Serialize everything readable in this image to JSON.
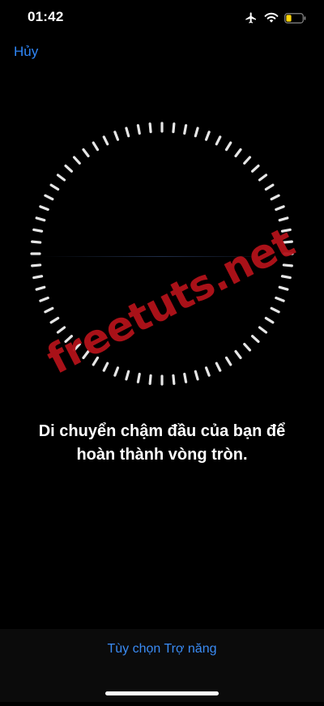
{
  "status_bar": {
    "time": "01:42",
    "icons": [
      "airplane-icon",
      "wifi-icon",
      "battery-icon"
    ],
    "battery_color": "#ffd60a"
  },
  "header": {
    "cancel_label": "Hủy"
  },
  "scan_ring": {
    "tick_count": 68,
    "tick_color": "#e6e6e6"
  },
  "watermark": {
    "text": "freetuts.net",
    "color": "#b3121a"
  },
  "instruction": {
    "line1": "Di chuyển chậm đầu của bạn để",
    "line2": "hoàn thành vòng tròn."
  },
  "footer": {
    "accessibility_options_label": "Tùy chọn Trợ năng"
  },
  "colors": {
    "accent": "#2f86f6",
    "background": "#000000"
  }
}
